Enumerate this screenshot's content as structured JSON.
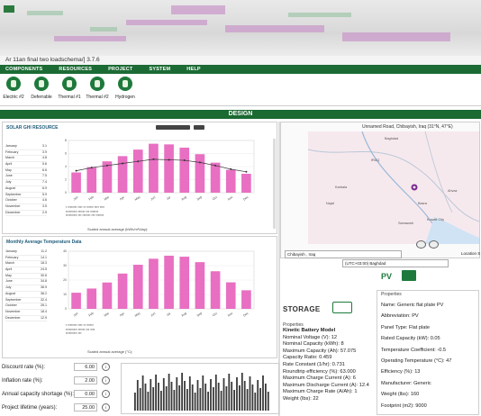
{
  "app": {
    "title": "Ar 11an final two loadschema/] 3.7.6"
  },
  "menu": [
    "COMPONENTS",
    "RESOURCES",
    "PROJECT",
    "SYSTEM",
    "HELP"
  ],
  "components": [
    {
      "label": "Electric #2",
      "icon": "generator-icon"
    },
    {
      "label": "Deferrable",
      "icon": "deferrable-load-icon"
    },
    {
      "label": "Thermal #1",
      "icon": "thermal-load-icon"
    },
    {
      "label": "Thermal #2",
      "icon": "thermal-load-icon"
    },
    {
      "label": "Hydrogen",
      "icon": "hydrogen-icon"
    }
  ],
  "design_bar": "DESIGN",
  "solar_panel": {
    "header": "SOLAR GHI RESOURCE",
    "chart_data": {
      "type": "bar",
      "categories": [
        "Jan",
        "Feb",
        "Mar",
        "Apr",
        "May",
        "Jun",
        "Jul",
        "Aug",
        "Sep",
        "Oct",
        "Nov",
        "Dec"
      ],
      "values": [
        3.1,
        3.9,
        4.8,
        5.6,
        6.6,
        7.5,
        7.4,
        6.9,
        5.9,
        4.6,
        3.5,
        2.9
      ],
      "line": [
        0.42,
        0.48,
        0.52,
        0.56,
        0.6,
        0.64,
        0.63,
        0.62,
        0.58,
        0.52,
        0.45,
        0.4
      ],
      "ylim": [
        0,
        8
      ]
    },
    "footer_label": "Scaled annual average (kWh/m²/day):"
  },
  "temp_panel": {
    "header": "Monthly Average Temperature Data",
    "chart_data": {
      "type": "bar",
      "categories": [
        "Jan",
        "Feb",
        "Mar",
        "Apr",
        "May",
        "Jun",
        "Jul",
        "Aug",
        "Sep",
        "Oct",
        "Nov",
        "Dec"
      ],
      "values": [
        11.2,
        14.1,
        18.3,
        24.5,
        30.6,
        34.8,
        36.9,
        36.2,
        32.4,
        26.1,
        18.4,
        12.9
      ],
      "ylim": [
        0,
        40
      ]
    },
    "footer_label": "Scaled annual average (°C):"
  },
  "map": {
    "title": "Unnamed Road, Chibayish, Iraq (31°N, 47°E)",
    "place_labels": [
      "Baghdad",
      "IRAQ",
      "Basra",
      "Ahvaz",
      "Kuwait City",
      "Karbala",
      "Najaf",
      "Samawah"
    ],
    "search_value": "Chibayish , Iraq",
    "timezone": "(UTC+03:00) Baghdad",
    "location_label": "Location S"
  },
  "storage": {
    "title": "STORAGE",
    "properties_header": "Properties",
    "rows": [
      "Kinetic Battery Model",
      "Nominal Voltage (V): 12",
      "Nominal Capacity (kWh): 8",
      "Maximum Capacity (Ah): 57.075",
      "Capacity Ratio: 0.459",
      "Rate Constant (1/hr): 0.731",
      "Roundtrip efficiency (%): 63.000",
      "Maximum Charge Current (A): 6",
      "Maximum Discharge Current (A): 12.4",
      "Maximum Charge Rate (A/Ah): 1",
      "Weight (lbs): 22"
    ]
  },
  "pv": {
    "title": "PV",
    "properties_header": "Properties",
    "rows": [
      "Name: Generic flat plate PV",
      "Abbreviation: PV",
      "Panel Type: Flat plate",
      "Rated Capacity (kW): 0.05",
      "Temperature Coefficient: -0.5",
      "Operating Temperature (°C): 47",
      "Efficiency (%): 13",
      "Manufacturer: Generic",
      "Weight (lbs): 160",
      "Footprint (m2): 9000"
    ]
  },
  "economics": [
    {
      "label": "Discount rate (%):",
      "value": "6.00"
    },
    {
      "label": "Inflation rate (%):",
      "value": "2.00"
    },
    {
      "label": "Annual capacity shortage (%):",
      "value": "0.00"
    },
    {
      "label": "Project lifetime (years):",
      "value": "25.00"
    }
  ],
  "colors": {
    "accent": "#1a6a31",
    "bar": "#e86fc2"
  }
}
